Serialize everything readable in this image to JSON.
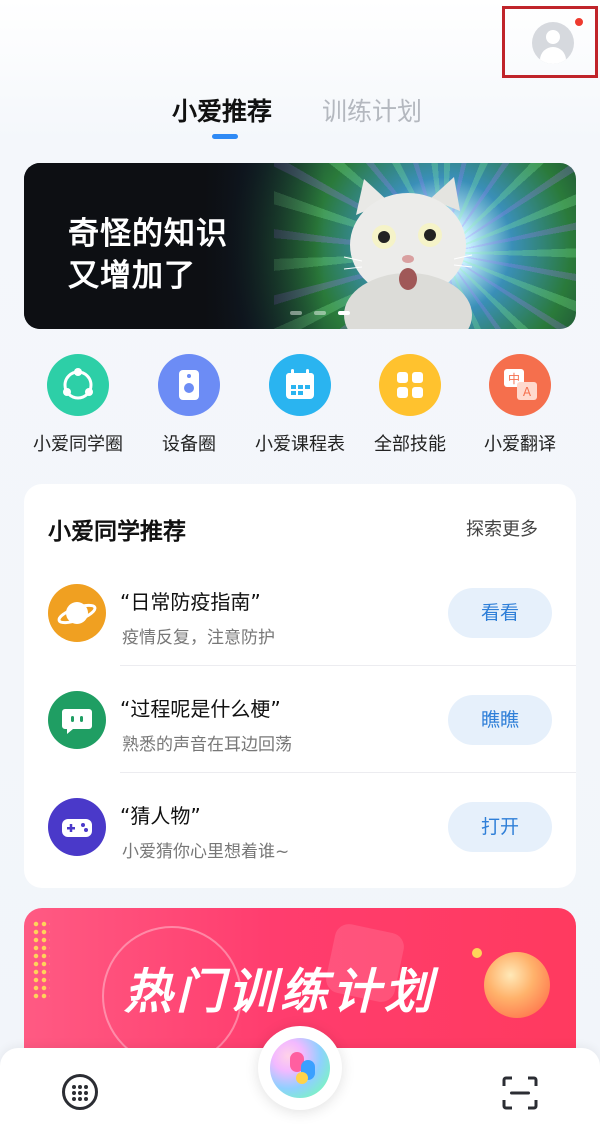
{
  "header": {
    "profile_badge_color": "#ee3b2f",
    "tabs": [
      {
        "label": "小爱推荐",
        "active": true
      },
      {
        "label": "训练计划",
        "active": false
      }
    ]
  },
  "banner": {
    "text_line1": "奇怪的知识",
    "text_line2": "又增加了",
    "image": "surprised-cat",
    "slide_count": 3,
    "active_slide": 3
  },
  "shortcuts": [
    {
      "label": "小爱同学圈",
      "icon": "share-circle-icon",
      "color": "#2dcfa7"
    },
    {
      "label": "设备圈",
      "icon": "speaker-icon",
      "color": "#6c8cf5"
    },
    {
      "label": "小爱课程表",
      "icon": "calendar-icon",
      "color": "#2ab4f0"
    },
    {
      "label": "全部技能",
      "icon": "grid-icon",
      "color": "#ffc22e"
    },
    {
      "label": "小爱翻译",
      "icon": "translate-icon",
      "color": "#f56f4d"
    }
  ],
  "recommend": {
    "title": "小爱同学推荐",
    "more_label": "探索更多",
    "items": [
      {
        "title": "“日常防疫指南”",
        "subtitle": "疫情反复，注意防护",
        "button": "看看",
        "icon": "planet-icon",
        "color": "#f0a021"
      },
      {
        "title": "“过程呢是什么梗”",
        "subtitle": "熟悉的声音在耳边回荡",
        "button": "瞧瞧",
        "icon": "chat-bubble-icon",
        "color": "#1f9e63"
      },
      {
        "title": "“猜人物”",
        "subtitle": "小爱猜你心里想着谁~",
        "button": "打开",
        "icon": "gamepad-icon",
        "color": "#4a39c9"
      }
    ]
  },
  "promo": {
    "text": "热门训练计划"
  },
  "bottom_bar": {
    "left_icon": "keypad-icon",
    "center_icon": "xiaoai-orb-icon",
    "right_icon": "scan-icon"
  }
}
